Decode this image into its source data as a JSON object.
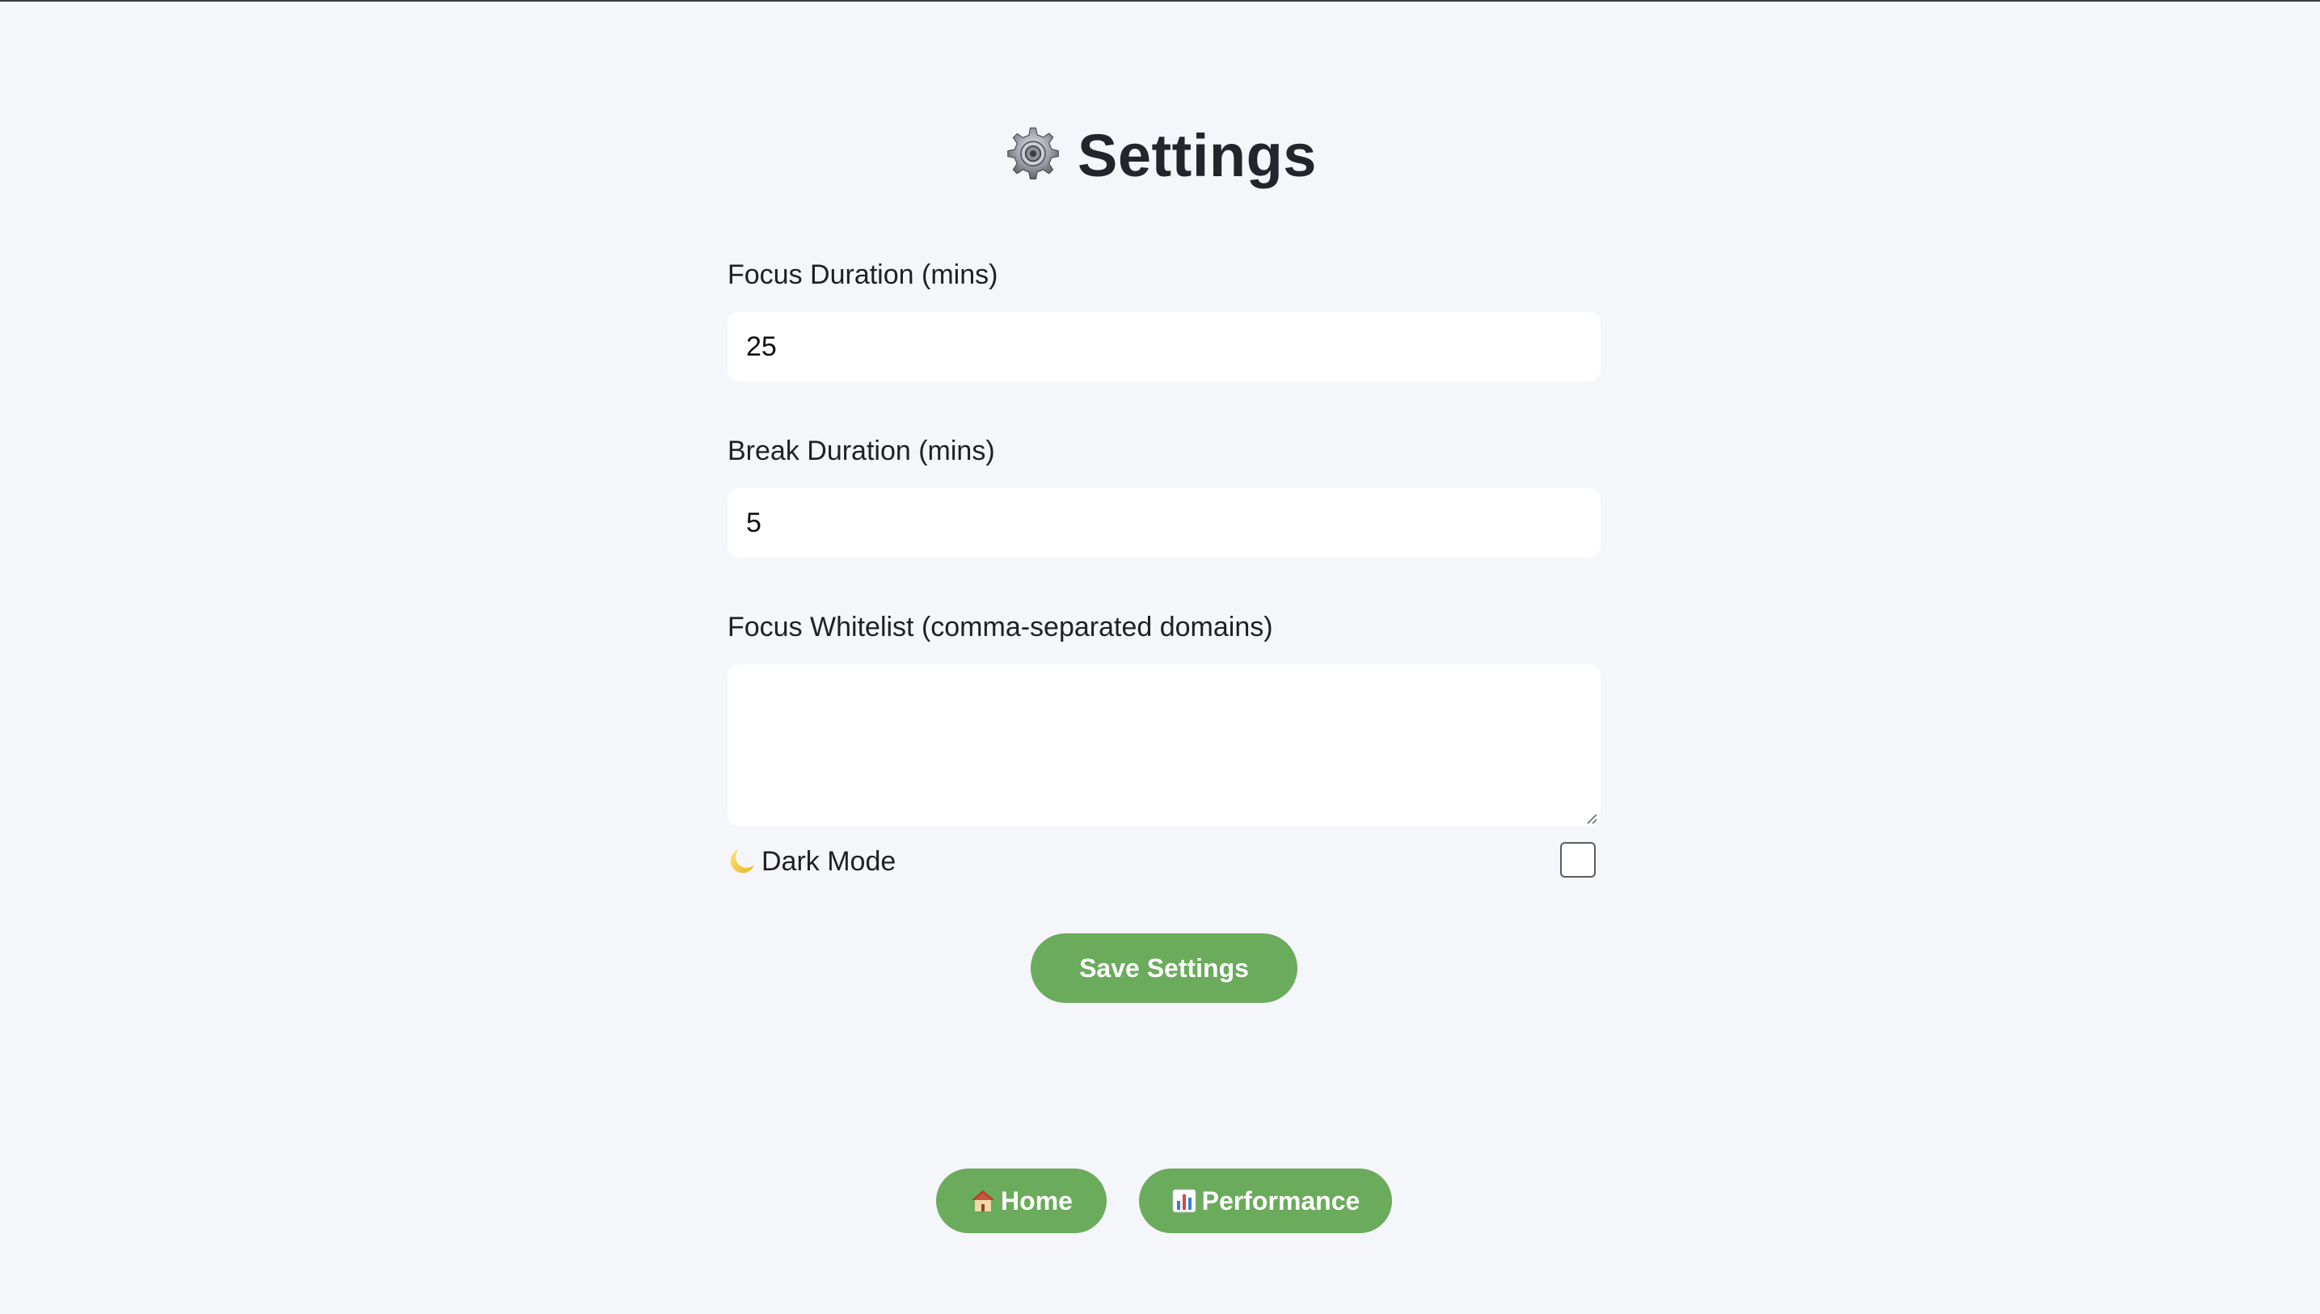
{
  "header": {
    "title": "Settings",
    "icon": "gear-icon"
  },
  "form": {
    "focus_duration": {
      "label": "Focus Duration (mins)",
      "value": "25"
    },
    "break_duration": {
      "label": "Break Duration (mins)",
      "value": "5"
    },
    "whitelist": {
      "label": "Focus Whitelist (comma-separated domains)",
      "value": ""
    },
    "dark_mode": {
      "label": "Dark Mode",
      "icon": "moon-icon",
      "checked": false
    },
    "save_label": "Save Settings"
  },
  "nav": {
    "home_label": "Home",
    "home_icon": "house-icon",
    "performance_label": "Performance",
    "performance_icon": "bar-chart-icon"
  },
  "colors": {
    "background": "#f5f6fa",
    "button": "#6aab5c",
    "button_text": "#ffffff",
    "input_bg": "#ffffff"
  }
}
